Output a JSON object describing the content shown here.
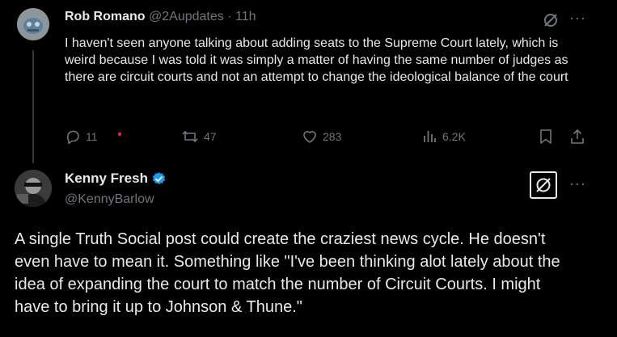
{
  "reply_tweet": {
    "author_name": "Rob Romano",
    "handle": "@2Aupdates",
    "separator": "·",
    "time": "11h",
    "text": "I haven't seen anyone talking about adding seats to the Supreme Court lately, which is weird because I was told it was simply a matter of having the same number of judges as there are circuit courts and not an attempt to change the ideological balance of the court",
    "actions": {
      "replies": "11",
      "retweets": "47",
      "likes": "283",
      "views": "6.2K"
    },
    "more_label": "···"
  },
  "main_tweet": {
    "author_name": "Kenny Fresh",
    "handle": "@KennyBarlow",
    "text": "A single Truth Social post could create the craziest news cycle. He doesn't even have to mean it. Something like \"I've been thinking alot lately about the idea of expanding the court to match the number of Circuit Courts. I might have to bring it up to Johnson & Thune.\"",
    "more_label": "···"
  },
  "colors": {
    "background": "#000000",
    "text": "#e7e9ea",
    "muted": "#71767b",
    "verified": "#1d9bf0",
    "thread_line": "#333639",
    "dot": "#f91880"
  }
}
